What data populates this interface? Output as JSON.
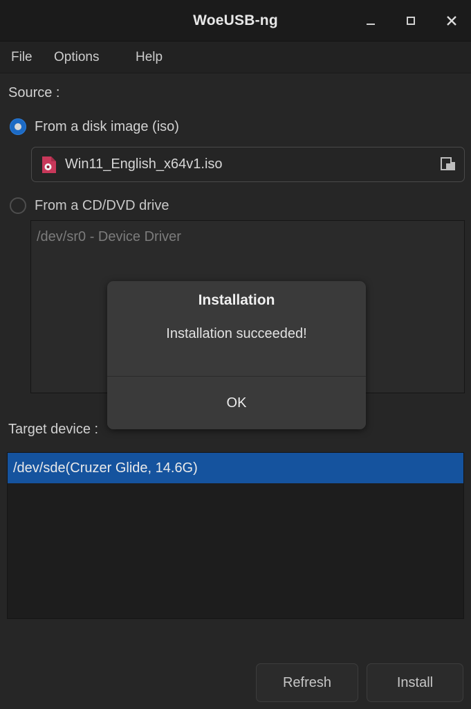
{
  "window": {
    "title": "WoeUSB-ng",
    "controls": {
      "minimize": "minimize-icon",
      "maximize": "maximize-icon",
      "close": "close-icon"
    }
  },
  "menubar": {
    "items": [
      {
        "label": "File"
      },
      {
        "label": "Options"
      },
      {
        "label": "Help"
      }
    ]
  },
  "source": {
    "label": "Source :",
    "iso_option": {
      "label": "From a disk image (iso)",
      "selected": true,
      "file_icon": "iso-file-icon",
      "filename": "Win11_English_x64v1.iso",
      "browse_icon": "open-file-icon"
    },
    "cd_option": {
      "label": "From a CD/DVD drive",
      "selected": false,
      "items": [
        "/dev/sr0 - Device Driver"
      ]
    }
  },
  "target": {
    "label": "Target device :",
    "items": [
      {
        "text": "/dev/sde(Cruzer Glide, 14.6G)",
        "selected": true
      }
    ]
  },
  "actions": {
    "refresh_label": "Refresh",
    "install_label": "Install"
  },
  "dialog": {
    "title": "Installation",
    "message": "Installation succeeded!",
    "ok_label": "OK"
  },
  "colors": {
    "window_background": "#1b1b1b",
    "menubar_background": "#222222",
    "body_background": "#262626",
    "accent_selected": "#15539e",
    "radio_accent": "#1c6ac4",
    "iso_icon": "#c8385a",
    "dialog_background": "#3a3a3a"
  }
}
